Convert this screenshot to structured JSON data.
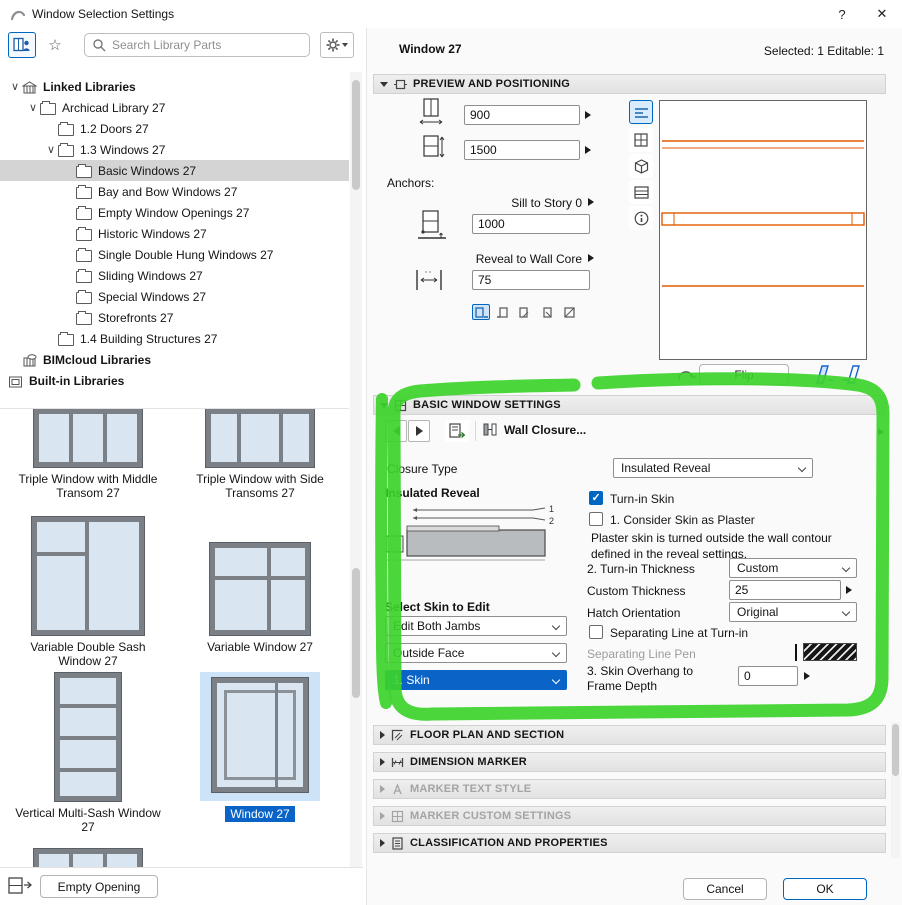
{
  "titlebar": {
    "title": "Window Selection Settings",
    "help": "?",
    "close": "✕"
  },
  "toolbar": {
    "search_placeholder": "Search Library Parts"
  },
  "tree": {
    "items": [
      {
        "label": "Linked Libraries"
      },
      {
        "label": "Archicad Library 27"
      },
      {
        "label": "1.2 Doors 27"
      },
      {
        "label": "1.3 Windows 27"
      },
      {
        "label": "Basic Windows 27"
      },
      {
        "label": "Bay and Bow Windows 27"
      },
      {
        "label": "Empty Window Openings 27"
      },
      {
        "label": "Historic Windows 27"
      },
      {
        "label": "Single Double Hung Windows 27"
      },
      {
        "label": "Sliding Windows 27"
      },
      {
        "label": "Special Windows 27"
      },
      {
        "label": "Storefronts 27"
      },
      {
        "label": "1.4 Building Structures 27"
      },
      {
        "label": "BIMcloud Libraries"
      },
      {
        "label": "Built-in Libraries"
      }
    ]
  },
  "thumbnails": [
    {
      "label": "Triple Window with Middle Transom 27"
    },
    {
      "label": "Triple Window with Side Transoms 27"
    },
    {
      "label": "Variable Double Sash Window 27"
    },
    {
      "label": "Variable Window 27"
    },
    {
      "label": "Vertical Multi-Sash Window 27"
    },
    {
      "label": "Window 27"
    }
  ],
  "bottom_left": {
    "empty_opening": "Empty Opening"
  },
  "header": {
    "title": "Window 27",
    "selection": "Selected: 1 Editable: 1"
  },
  "preview": {
    "section_title": "PREVIEW AND POSITIONING",
    "width_value": "900",
    "height_value": "1500",
    "anchors_label": "Anchors:",
    "sill_label": "Sill to Story 0",
    "sill_value": "1000",
    "reveal_label": "Reveal to Wall Core",
    "reveal_value": "75",
    "flip_label": "Flip"
  },
  "basic": {
    "section_title": "BASIC WINDOW SETTINGS",
    "wall_closure_label": "Wall Closure...",
    "closure_type_label": "Closure Type",
    "closure_type_value": "Insulated Reveal",
    "reveal_diagram_title": "Insulated Reveal",
    "diagram_label_1": "1",
    "diagram_label_2": "2",
    "turn_in_skin_label": "Turn-in Skin",
    "consider_plaster_label": "1. Consider Skin as Plaster",
    "plaster_note": "Plaster skin is turned outside the wall contour defined in the reveal settings.",
    "turn_in_thickness_label": "2. Turn-in Thickness",
    "turn_in_thickness_value": "Custom",
    "custom_thickness_label": "Custom Thickness",
    "custom_thickness_value": "25",
    "hatch_orientation_label": "Hatch Orientation",
    "hatch_orientation_value": "Original",
    "separating_line_label": "Separating Line at Turn-in",
    "separating_line_pen_label": "Separating Line Pen",
    "skin_overhang_label": "3. Skin Overhang to Frame Depth",
    "skin_overhang_value": "0",
    "select_skin_title": "Select Skin to Edit",
    "skin_select_1": "Edit Both Jambs",
    "skin_select_2": "Outside Face",
    "skin_select_3": "1. Skin"
  },
  "sections": [
    {
      "label": "FLOOR PLAN AND SECTION"
    },
    {
      "label": "DIMENSION MARKER"
    },
    {
      "label": "MARKER TEXT STYLE"
    },
    {
      "label": "MARKER CUSTOM SETTINGS"
    },
    {
      "label": "CLASSIFICATION AND PROPERTIES"
    }
  ],
  "footer": {
    "cancel": "Cancel",
    "ok": "OK"
  },
  "colors": {
    "accent": "#0067c0",
    "annotation": "#3cd32b",
    "preview_line": "#e05a00"
  }
}
